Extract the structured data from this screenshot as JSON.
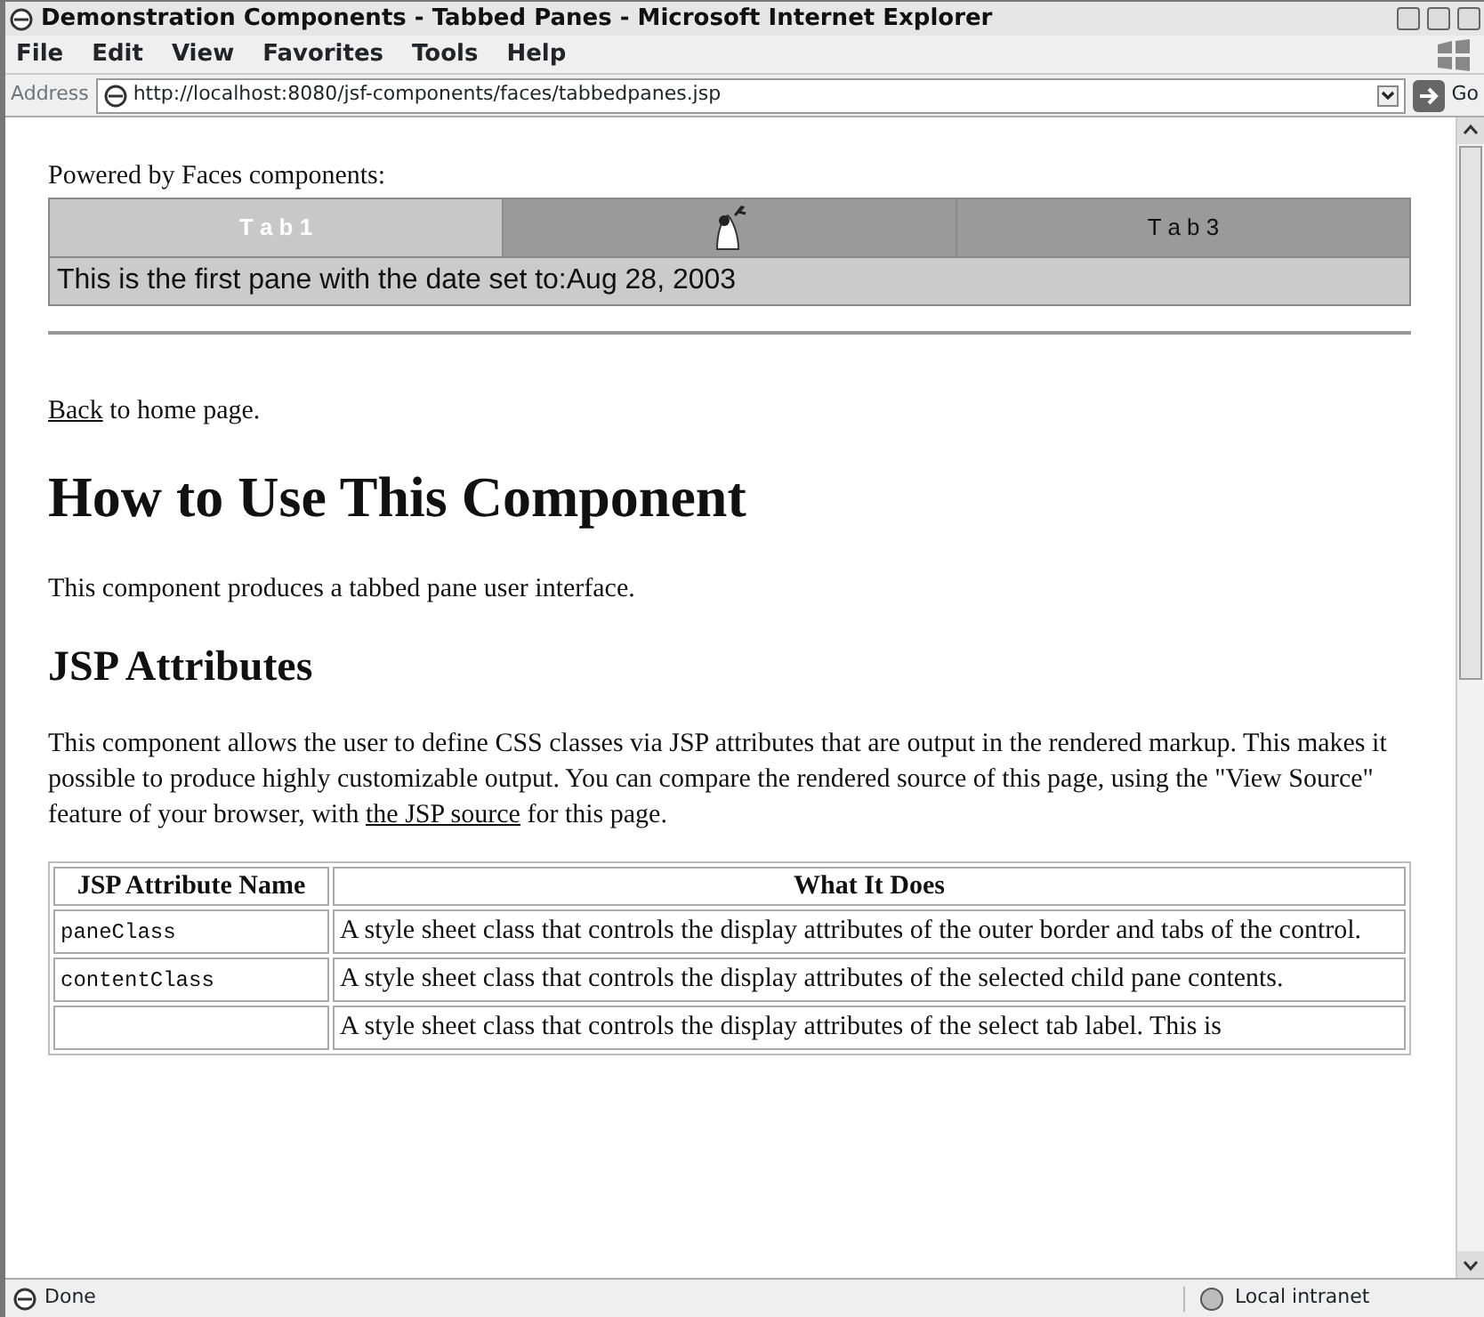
{
  "window": {
    "title": "Demonstration Components - Tabbed Panes - Microsoft Internet Explorer"
  },
  "menu": [
    "File",
    "Edit",
    "View",
    "Favorites",
    "Tools",
    "Help"
  ],
  "address_bar": {
    "label": "Address",
    "url": "http://localhost:8080/jsf-components/faces/tabbedpanes.jsp",
    "go": "Go"
  },
  "page": {
    "powered_by": "Powered by Faces components:",
    "tabs": [
      {
        "kind": "text",
        "label": "T a b 1",
        "selected": true
      },
      {
        "kind": "icon",
        "selected": false
      },
      {
        "kind": "text",
        "label": "T a b 3",
        "selected": false
      }
    ],
    "pane_text": "This is the first pane with the date set to:Aug 28, 2003",
    "back_link": "Back",
    "back_rest": " to home page.",
    "heading": "How to Use This Component",
    "intro": "This component produces a tabbed pane user interface.",
    "subheading": "JSP Attributes",
    "paragraph": {
      "before": "This component allows the user to define CSS classes via JSP attributes that are output in the rendered markup. This makes it possible to produce highly customizable output. You can compare the rendered source of this page, using the \"View Source\" feature of your browser, with ",
      "link": "the JSP source",
      "after": " for this page."
    },
    "table": {
      "columns": [
        "JSP Attribute Name",
        "What It Does"
      ],
      "rows": [
        [
          "paneClass",
          "A style sheet class that controls the display attributes of the outer border and tabs of the control."
        ],
        [
          "contentClass",
          "A style sheet class that controls the display attributes of the selected child pane contents."
        ],
        [
          "",
          "A style sheet class that controls the display attributes of the select tab label. This is"
        ]
      ]
    }
  },
  "status_bar": {
    "text": "Done",
    "zone": "Local intranet"
  }
}
